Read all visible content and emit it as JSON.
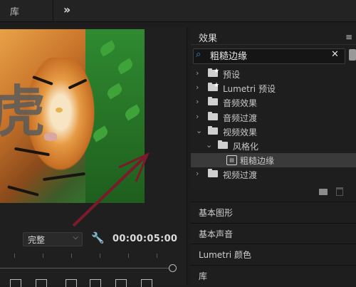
{
  "top_bar": {
    "tab_label": "库",
    "expand_icon": "double-chevron-right-icon"
  },
  "monitor": {
    "overlay_char": "虎",
    "quality": "完整",
    "timecode": "00:00:05:00"
  },
  "effects": {
    "tab_label": "效果",
    "search_value": "粗糙边缘",
    "tree": [
      {
        "label": "预设",
        "depth": 0,
        "expanded": false,
        "kind": "preset-folder"
      },
      {
        "label": "Lumetri 预设",
        "depth": 0,
        "expanded": false,
        "kind": "preset-folder"
      },
      {
        "label": "音频效果",
        "depth": 0,
        "expanded": false,
        "kind": "folder"
      },
      {
        "label": "音频过渡",
        "depth": 0,
        "expanded": false,
        "kind": "folder"
      },
      {
        "label": "视频效果",
        "depth": 0,
        "expanded": true,
        "kind": "folder"
      },
      {
        "label": "风格化",
        "depth": 1,
        "expanded": true,
        "kind": "folder"
      },
      {
        "label": "粗糙边缘",
        "depth": 2,
        "expanded": false,
        "kind": "effect",
        "selected": true
      },
      {
        "label": "视频过渡",
        "depth": 0,
        "expanded": false,
        "kind": "folder"
      }
    ]
  },
  "collapsed_panels": [
    "基本图形",
    "基本声音",
    "Lumetri 颜色",
    "库"
  ],
  "colors": {
    "accent": "#3a8cd6",
    "annotation_arrow": "#7a1a2a",
    "panel_bg": "#1e1e1e"
  }
}
